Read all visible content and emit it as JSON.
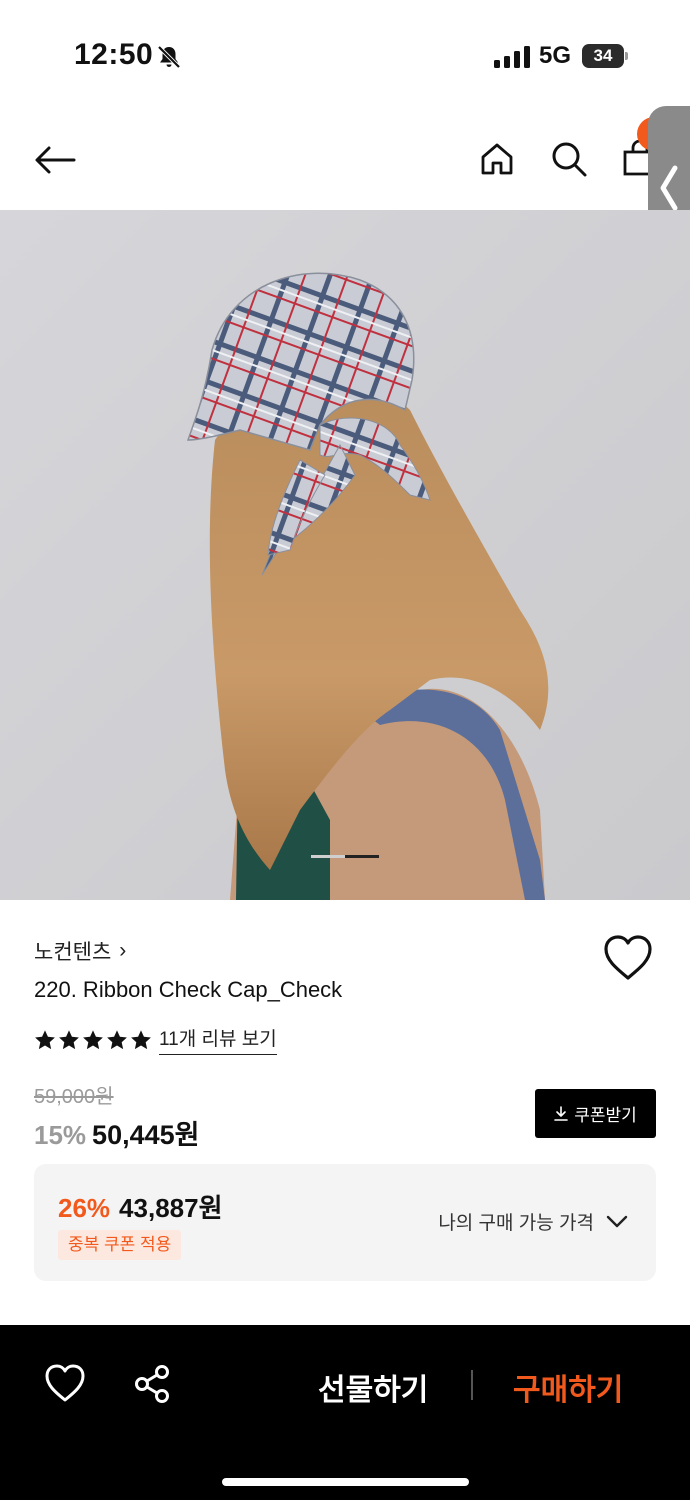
{
  "status_bar": {
    "time": "12:50",
    "network": "5G",
    "battery": "34"
  },
  "header": {
    "icons": [
      "back-arrow-icon",
      "home-icon",
      "search-icon",
      "shopping-bag-icon",
      "chevron-left-icon"
    ]
  },
  "gallery": {
    "current_index": 2,
    "total": 2
  },
  "product": {
    "brand": "노컨텐츠",
    "brand_chevron": "›",
    "name": "220. Ribbon Check Cap_Check",
    "rating_stars": 5,
    "review_link": "11개 리뷰 보기",
    "original_price": "59,000원",
    "discount": "15%",
    "price": "50,445원",
    "coupon_button": "쿠폰받기"
  },
  "my_price": {
    "discount": "26%",
    "price": "43,887원",
    "badge": "중복 쿠폰 적용",
    "link": "나의 구매 가능 가격"
  },
  "bottom_bar": {
    "gift_label": "선물하기",
    "buy_label": "구매하기"
  },
  "colors": {
    "accent": "#f25a1d",
    "black": "#000000"
  }
}
